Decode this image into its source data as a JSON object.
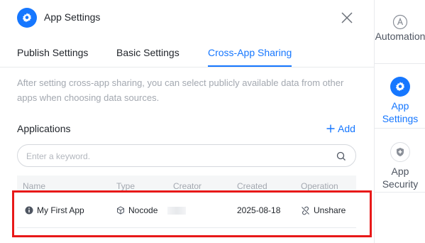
{
  "header": {
    "title": "App Settings",
    "icon": "gear-icon",
    "close_icon": "close-icon"
  },
  "tabs": [
    {
      "label": "Publish Settings",
      "active": false
    },
    {
      "label": "Basic Settings",
      "active": false
    },
    {
      "label": "Cross-App Sharing",
      "active": true
    }
  ],
  "description": "After setting cross-app sharing, you can select publicly available data from other apps when choosing data sources.",
  "applications": {
    "title": "Applications",
    "add_label": "Add",
    "search_placeholder": "Enter a keyword.",
    "columns": [
      "Name",
      "Type",
      "Creator",
      "Created",
      "Operation"
    ],
    "rows": [
      {
        "name": "My First App",
        "type": "Nocode",
        "creator": "",
        "created": "2025-08-18",
        "operation": "Unshare"
      }
    ]
  },
  "sidebar": {
    "items": [
      {
        "label_line1": "Automation",
        "label_line2": "",
        "icon": "automation-icon",
        "active": false
      },
      {
        "label_line1": "App",
        "label_line2": "Settings",
        "icon": "gear-icon",
        "active": true
      },
      {
        "label_line1": "App",
        "label_line2": "Security",
        "icon": "shield-icon",
        "active": false
      }
    ]
  },
  "colors": {
    "accent": "#1677ff",
    "highlight": "#e81919",
    "muted_text": "#a3a8b0"
  }
}
